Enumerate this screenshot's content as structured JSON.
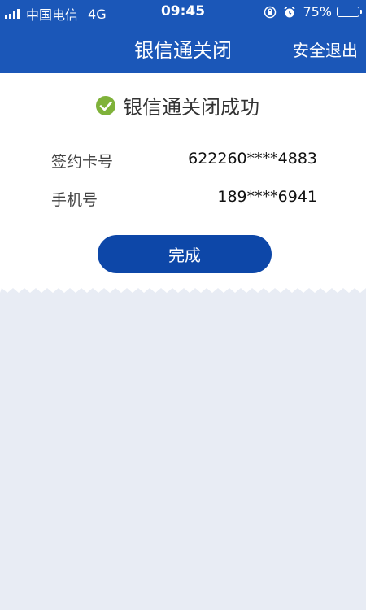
{
  "status_bar": {
    "carrier": "中国电信",
    "network": "4G",
    "time": "09:45",
    "battery_percent": "75%",
    "battery_level": 0.75
  },
  "nav": {
    "title": "银信通关闭",
    "action_label": "安全退出"
  },
  "result": {
    "message": "银信通关闭成功",
    "icon": "check-circle-icon"
  },
  "details": [
    {
      "label": "签约卡号",
      "value": "622260****4883"
    },
    {
      "label": "手机号",
      "value": "189****6941"
    }
  ],
  "done_button": {
    "label": "完成"
  },
  "colors": {
    "header_bg": "#1b57b8",
    "button_bg": "#0d47a8",
    "page_bg": "#e8ecf4",
    "check_green": "#7fb23a"
  }
}
